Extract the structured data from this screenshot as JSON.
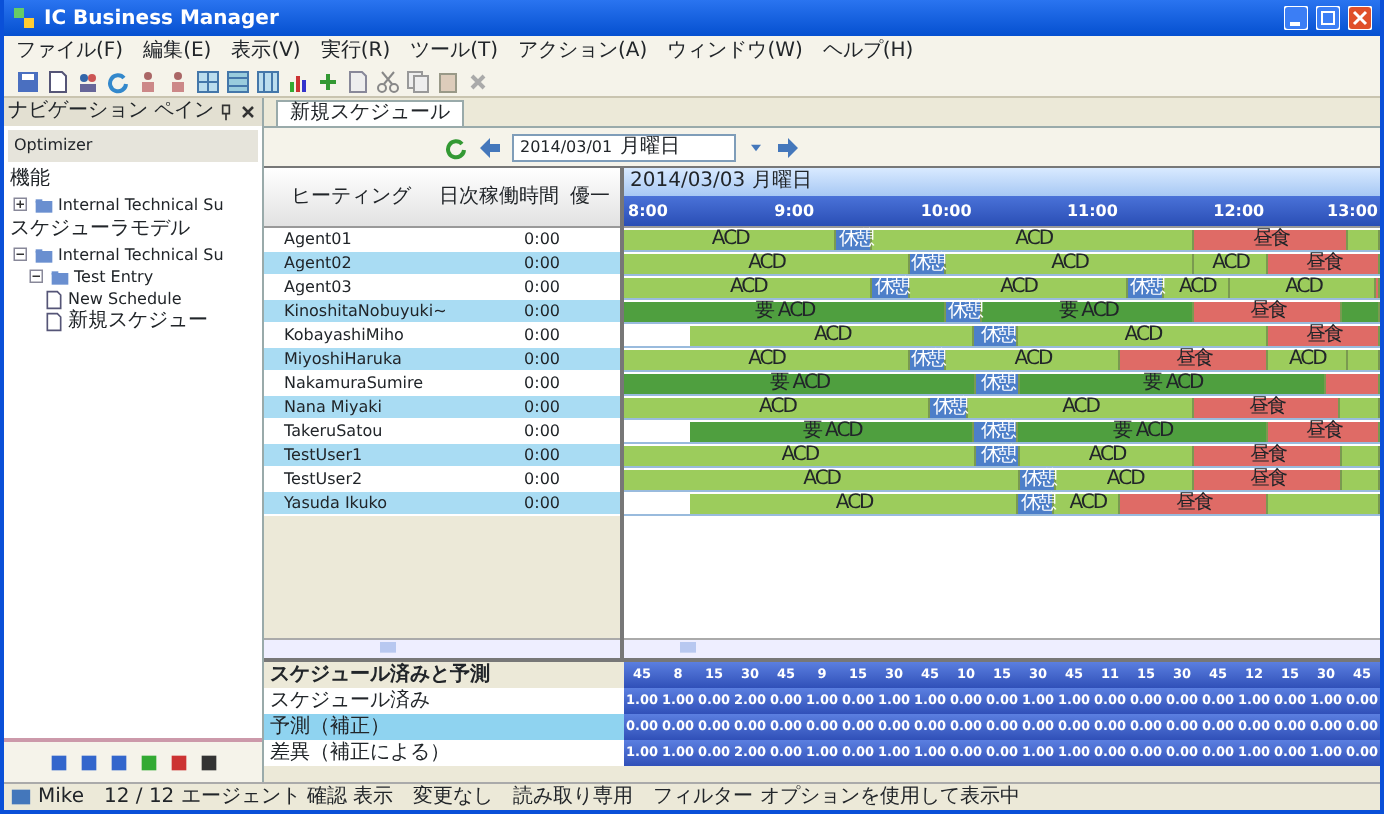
{
  "window": {
    "title": "IC Business Manager"
  },
  "menu": [
    "ファイル(F)",
    "編集(E)",
    "表示(V)",
    "実行(R)",
    "ツール(T)",
    "アクション(A)",
    "ウィンドウ(W)",
    "ヘルプ(H)"
  ],
  "nav": {
    "title": "ナビゲーション ペイン",
    "product": "Optimizer",
    "sections": [
      {
        "label": "機能",
        "items": [
          {
            "label": "Internal Technical Su",
            "expanded": false
          }
        ]
      },
      {
        "label": "スケジューラモデル",
        "items": [
          {
            "label": "Internal Technical Su",
            "expanded": true,
            "children": [
              {
                "label": "Test Entry",
                "expanded": true,
                "children": [
                  {
                    "label": "New Schedule"
                  },
                  {
                    "label": "新規スケジュー"
                  }
                ]
              }
            ]
          }
        ]
      }
    ]
  },
  "tabs": [
    {
      "label": "新規スケジュール",
      "selected": true
    }
  ],
  "date_bar": {
    "date": "2014/03/01",
    "weekday": "月曜日"
  },
  "grid": {
    "columns": [
      "ヒーティング",
      "日次稼働時間",
      "優一"
    ],
    "rows": [
      {
        "name": "Agent01",
        "hours": "0:00",
        "segments": [
          {
            "kind": "acd",
            "label": "ACD"
          },
          {
            "kind": "break",
            "label": "休憩"
          },
          {
            "kind": "acd",
            "label": "ACD"
          },
          {
            "kind": "lunch",
            "label": "昼食"
          },
          {
            "kind": "acd"
          }
        ]
      },
      {
        "name": "Agent02",
        "hours": "0:00",
        "segments": [
          {
            "kind": "acd",
            "label": "ACD"
          },
          {
            "kind": "break",
            "label": "休憩"
          },
          {
            "kind": "acd",
            "label": "ACD"
          },
          {
            "kind": "acd",
            "label": "ACD"
          },
          {
            "kind": "lunch",
            "label": "昼食"
          }
        ]
      },
      {
        "name": "Agent03",
        "hours": "0:00",
        "segments": [
          {
            "kind": "acd",
            "label": "ACD"
          },
          {
            "kind": "break",
            "label": "休憩"
          },
          {
            "kind": "acd",
            "label": "ACD"
          },
          {
            "kind": "break",
            "label": "休憩"
          },
          {
            "kind": "acd",
            "label": "ACD"
          },
          {
            "kind": "acd",
            "label": "ACD"
          },
          {
            "kind": "lunch"
          }
        ]
      },
      {
        "name": "KinoshitaNobuyuki~",
        "hours": "0:00",
        "segments": [
          {
            "kind": "req",
            "label": "要 ACD"
          },
          {
            "kind": "break",
            "label": "休憩"
          },
          {
            "kind": "req",
            "label": "要 ACD"
          },
          {
            "kind": "lunch",
            "label": "昼食"
          },
          {
            "kind": "req"
          }
        ]
      },
      {
        "name": "KobayashiMiho",
        "hours": "0:00",
        "segments": [
          {
            "kind": "free"
          },
          {
            "kind": "acd",
            "label": "ACD"
          },
          {
            "kind": "break",
            "label": "休憩"
          },
          {
            "kind": "acd",
            "label": "ACD"
          },
          {
            "kind": "lunch",
            "label": "昼食"
          }
        ]
      },
      {
        "name": "MiyoshiHaruka",
        "hours": "0:00",
        "segments": [
          {
            "kind": "acd",
            "label": "ACD"
          },
          {
            "kind": "break",
            "label": "休憩"
          },
          {
            "kind": "acd",
            "label": "ACD"
          },
          {
            "kind": "lunch",
            "label": "昼食"
          },
          {
            "kind": "acd",
            "label": "ACD"
          },
          {
            "kind": "acd"
          }
        ]
      },
      {
        "name": "NakamuraSumire",
        "hours": "0:00",
        "segments": [
          {
            "kind": "req",
            "label": "要 ACD"
          },
          {
            "kind": "break",
            "label": "休憩"
          },
          {
            "kind": "req",
            "label": "要 ACD"
          },
          {
            "kind": "lunch"
          }
        ]
      },
      {
        "name": "Nana Miyaki",
        "hours": "0:00",
        "segments": [
          {
            "kind": "acd",
            "label": "ACD"
          },
          {
            "kind": "break",
            "label": "休憩"
          },
          {
            "kind": "acd",
            "label": "ACD"
          },
          {
            "kind": "lunch",
            "label": "昼食"
          },
          {
            "kind": "acd"
          }
        ]
      },
      {
        "name": "TakeruSatou",
        "hours": "0:00",
        "segments": [
          {
            "kind": "free"
          },
          {
            "kind": "req",
            "label": "要 ACD"
          },
          {
            "kind": "break",
            "label": "休憩"
          },
          {
            "kind": "req",
            "label": "要 ACD"
          },
          {
            "kind": "lunch",
            "label": "昼食"
          }
        ]
      },
      {
        "name": "TestUser1",
        "hours": "0:00",
        "segments": [
          {
            "kind": "acd",
            "label": "ACD"
          },
          {
            "kind": "break",
            "label": "休憩"
          },
          {
            "kind": "acd",
            "label": "ACD"
          },
          {
            "kind": "lunch",
            "label": "昼食"
          },
          {
            "kind": "acd"
          }
        ]
      },
      {
        "name": "TestUser2",
        "hours": "0:00",
        "segments": [
          {
            "kind": "acd",
            "label": "ACD"
          },
          {
            "kind": "break",
            "label": "休憩"
          },
          {
            "kind": "acd",
            "label": "ACD"
          },
          {
            "kind": "lunch",
            "label": "昼食"
          },
          {
            "kind": "acd"
          }
        ]
      },
      {
        "name": "Yasuda Ikuko",
        "hours": "0:00",
        "segments": [
          {
            "kind": "free"
          },
          {
            "kind": "acd",
            "label": "ACD"
          },
          {
            "kind": "break",
            "label": "休憩"
          },
          {
            "kind": "acd",
            "label": "ACD"
          },
          {
            "kind": "lunch",
            "label": "昼食"
          },
          {
            "kind": "acd"
          }
        ]
      }
    ]
  },
  "timeline": {
    "date": "2014/03/03 月曜日",
    "ticks": [
      "8:00",
      "9:00",
      "10:00",
      "11:00",
      "12:00",
      "13:00"
    ]
  },
  "summary": {
    "title": "スケジュール済みと予測",
    "columns": [
      "45",
      "8",
      "15",
      "30",
      "45",
      "9",
      "15",
      "30",
      "45",
      "10",
      "15",
      "30",
      "45",
      "11",
      "15",
      "30",
      "45",
      "12",
      "15",
      "30",
      "45"
    ],
    "rows": [
      {
        "label": "スケジュール済み",
        "values": [
          "1.00",
          "1.00",
          "0.00",
          "2.00",
          "0.00",
          "1.00",
          "0.00",
          "1.00",
          "1.00",
          "0.00",
          "0.00",
          "1.00",
          "1.00",
          "0.00",
          "0.00",
          "0.00",
          "0.00",
          "1.00",
          "0.00",
          "1.00",
          "0.00"
        ]
      },
      {
        "label": "予測（補正）",
        "values": [
          "0.00",
          "0.00",
          "0.00",
          "0.00",
          "0.00",
          "0.00",
          "0.00",
          "0.00",
          "0.00",
          "0.00",
          "0.00",
          "0.00",
          "0.00",
          "0.00",
          "0.00",
          "0.00",
          "0.00",
          "0.00",
          "0.00",
          "0.00",
          "0.00"
        ]
      },
      {
        "label": "差異（補正による）",
        "values": [
          "1.00",
          "1.00",
          "0.00",
          "2.00",
          "0.00",
          "1.00",
          "0.00",
          "1.00",
          "1.00",
          "0.00",
          "0.00",
          "1.00",
          "1.00",
          "0.00",
          "0.00",
          "0.00",
          "0.00",
          "1.00",
          "0.00",
          "1.00",
          "0.00"
        ]
      }
    ]
  },
  "status_bar": "Mike　12 / 12 エージェント 確認 表示　変更なし　読み取り専用　フィルター オプションを使用して表示中"
}
